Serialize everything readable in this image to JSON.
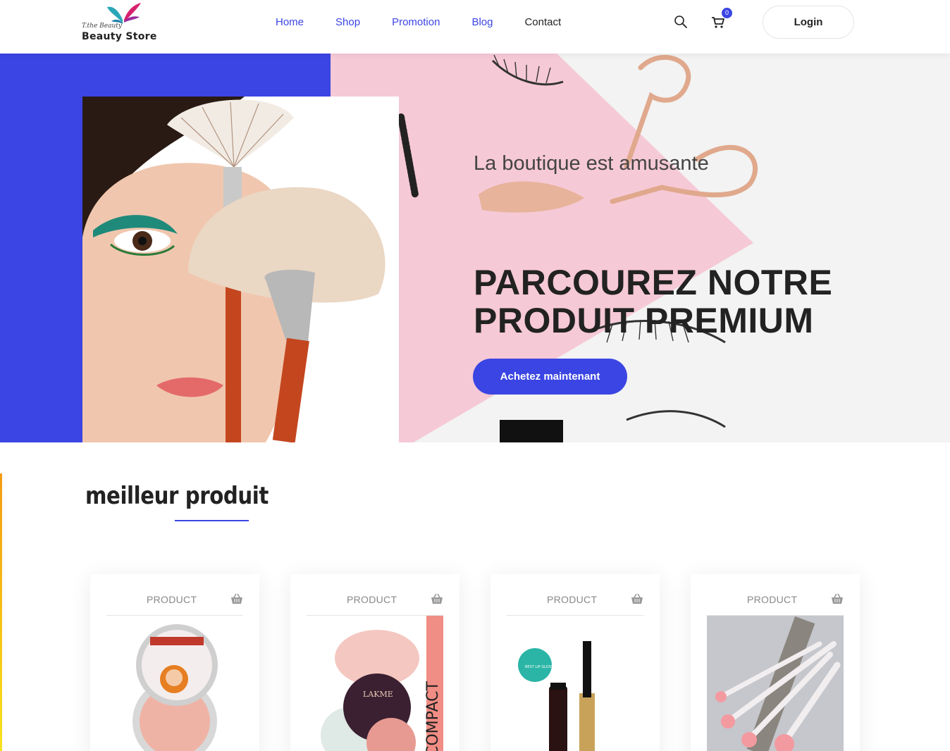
{
  "logo": {
    "script": "T.the Beauty",
    "name": "Beauty Store"
  },
  "nav": {
    "items": [
      {
        "label": "Home"
      },
      {
        "label": "Shop"
      },
      {
        "label": "Promotion"
      },
      {
        "label": "Blog"
      },
      {
        "label": "Contact"
      }
    ]
  },
  "header": {
    "cart_count": "0",
    "login_label": "Login"
  },
  "hero": {
    "subtitle": "La boutique est amusante",
    "title_line1": "PARCOUREZ NOTRE",
    "title_line2": "PRODUIT PREMIUM",
    "cta": "Achetez maintenant"
  },
  "section": {
    "title": "meilleur produit"
  },
  "products": [
    {
      "label": "PRODUCT"
    },
    {
      "label": "PRODUCT"
    },
    {
      "label": "PRODUCT"
    },
    {
      "label": "PRODUCT"
    }
  ],
  "product_images": {
    "compact_text": "COMPACT",
    "lakme_text": "LAKME",
    "gloss_text": "BEST LIP GLOSS"
  },
  "colors": {
    "accent": "#3b45e3",
    "pink": "#f6c9d6"
  }
}
